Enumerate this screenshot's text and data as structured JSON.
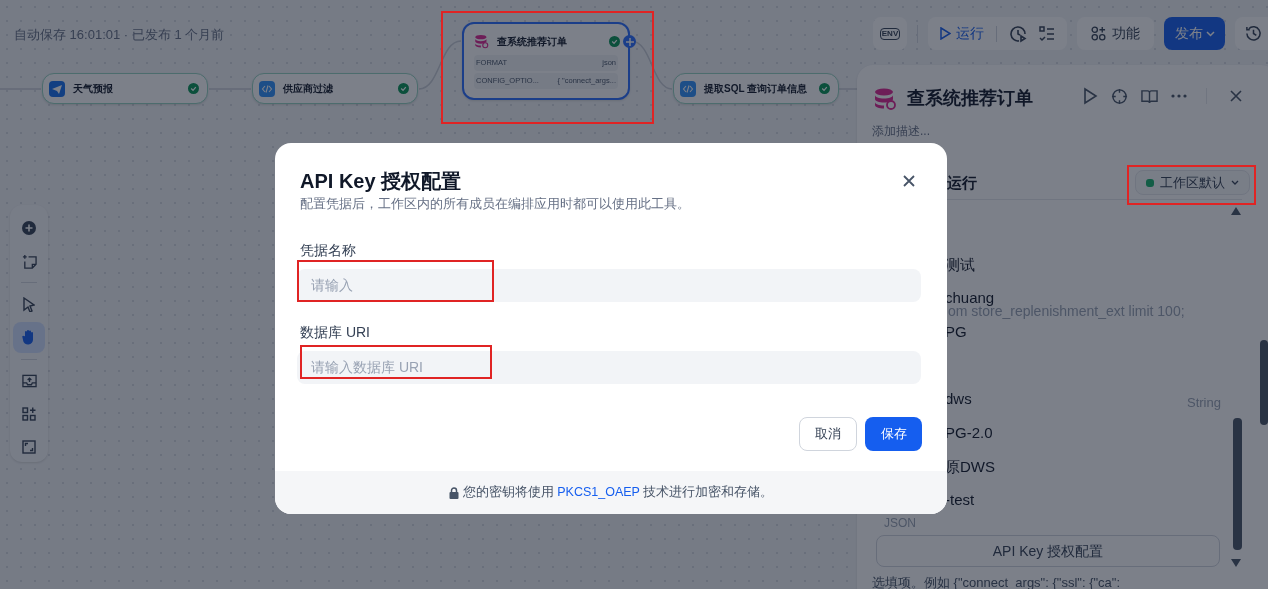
{
  "autosave": "自动保存 16:01:01 · 已发布 1 个月前",
  "nodes": [
    {
      "kind": "tool",
      "title": "天气预报",
      "selected": false,
      "done": true
    },
    {
      "kind": "code",
      "title": "供应商过滤",
      "selected": false,
      "done": true
    },
    {
      "kind": "database",
      "title": "查系统推荐订单",
      "selected": true,
      "done": true,
      "params": [
        {
          "key": "FORMAT",
          "value": "json"
        },
        {
          "key": "CONFIG_OPTIO...",
          "value": "{ \"connect_args..."
        }
      ]
    },
    {
      "kind": "code",
      "title": "提取SQL 查询订单信息",
      "selected": false,
      "done": true
    }
  ],
  "toolbar": {
    "env": "ENV",
    "run": "运行",
    "features": "功能",
    "publish": "发布"
  },
  "canvas_tools": [
    {
      "selected": false
    },
    {
      "selected": false
    },
    {
      "selected": false
    },
    {
      "selected": true
    },
    {
      "selected": false
    },
    {
      "selected": false
    },
    {
      "selected": false
    }
  ],
  "panel": {
    "title": "查系统推荐订单",
    "description": "添加描述...",
    "section": "运行",
    "environment": "工作区默认",
    "options": [
      "测试",
      "chuang",
      "PG",
      "dws",
      "PG-2.0",
      "原DWS",
      "-test"
    ],
    "sql_fragment": "om store_replenishment_ext limit 100;",
    "type_tag": "String",
    "format_tag": "JSON",
    "auth_button": "API Key 授权配置",
    "hint": "选填项。例如 {\"connect_args\": {\"ssl\": {\"ca\":"
  },
  "dialog": {
    "title": "API Key 授权配置",
    "subtitle": "配置凭据后，工作区内的所有成员在编排应用时都可以使用此工具。",
    "fields": [
      {
        "label": "凭据名称",
        "placeholder": "请输入"
      },
      {
        "label": "数据库 URI",
        "placeholder": "请输入数据库 URI"
      }
    ],
    "buttons": [
      {
        "kind": "secondary",
        "label": "取消"
      },
      {
        "kind": "primary",
        "label": "保存"
      }
    ],
    "footer_before": "您的密钥将使用",
    "footer_link": "PKCS1_OAEP",
    "footer_after": "技术进行加密和存储。"
  }
}
